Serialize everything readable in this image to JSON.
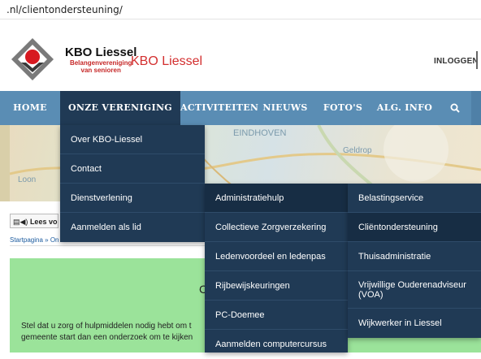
{
  "browser": {
    "url": ".nl/clientondersteuning/"
  },
  "header": {
    "logo_title": "KBO Liessel",
    "logo_sub1": "Belangenvereniging",
    "logo_sub2": "van senioren",
    "site_title": "KBO Liessel",
    "login": "INLOGGEN"
  },
  "nav": {
    "items": [
      {
        "label": "HOME"
      },
      {
        "label": "ONZE VERENIGING"
      },
      {
        "label": "ACTIVITEITEN"
      },
      {
        "label": "NIEUWS"
      },
      {
        "label": "FOTO'S"
      },
      {
        "label": "ALG. INFO"
      }
    ]
  },
  "menu1": {
    "items": [
      {
        "label": "Over KBO-Liessel"
      },
      {
        "label": "Contact"
      },
      {
        "label": "Dienstverlening"
      },
      {
        "label": "Aanmelden als lid"
      }
    ]
  },
  "menu2": {
    "items": [
      {
        "label": "Administratiehulp"
      },
      {
        "label": "Collectieve Zorgverzekering"
      },
      {
        "label": "Ledenvoordeel en ledenpas"
      },
      {
        "label": "Rijbewijskeuringen"
      },
      {
        "label": "PC-Doemee"
      },
      {
        "label": "Aanmelden computercursus"
      }
    ]
  },
  "menu3": {
    "items": [
      {
        "label": "Belastingservice"
      },
      {
        "label": "Cliëntondersteuning"
      },
      {
        "label": "Thuisadministratie"
      },
      {
        "label": "Vrijwillige Ouderenadviseur (VOA)"
      },
      {
        "label": "Wijkwerker in Liessel"
      }
    ]
  },
  "hero": {
    "map_label_1": "EINDHOVEN",
    "map_label_2": "Geldrop",
    "map_label_3": "Loon"
  },
  "content": {
    "readspeaker_label": "Lees vo",
    "breadcrumb": "Startpagina » On",
    "heading_fragment": "C",
    "text_line1": "Stel dat u zorg of hulpmiddelen nodig hebt om t",
    "text_line2": "gemeente start dan een onderzoek om te kijken"
  }
}
